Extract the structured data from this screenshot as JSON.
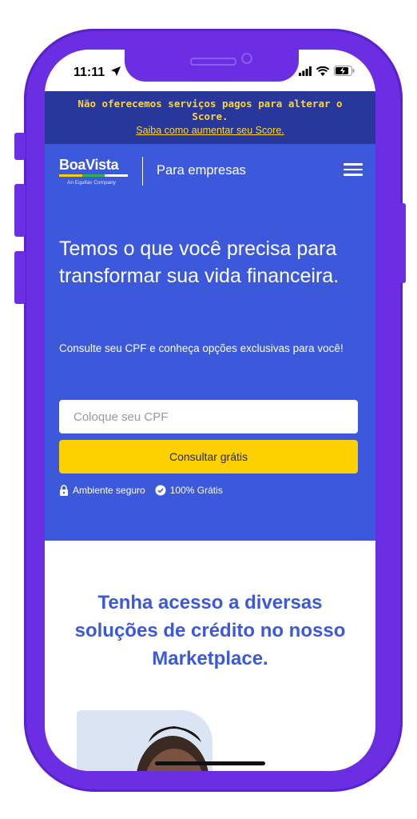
{
  "status_bar": {
    "time": "11:11"
  },
  "notice": {
    "text": "Não oferecemos serviços pagos para alterar o Score.",
    "link": "Saiba como aumentar seu Score."
  },
  "header": {
    "logo_text": "BoaVista",
    "logo_subtext": "An Equifax Company",
    "for_business": "Para empresas"
  },
  "hero": {
    "headline": "Temos o que você precisa para transformar sua vida financeira.",
    "subline": "Consulte seu CPF e conheça opções exclusivas para você!",
    "cpf_placeholder": "Coloque seu CPF",
    "cta_label": "Consultar grátis",
    "badge_secure": "Ambiente seguro",
    "badge_free": "100% Grátis"
  },
  "marketplace": {
    "title": "Tenha acesso a diversas soluções de crédito no nosso Marketplace."
  },
  "icons": {
    "location": "location-arrow-icon",
    "signal": "signal-icon",
    "wifi": "wifi-icon",
    "battery": "battery-charging-icon",
    "menu": "hamburger-menu-icon",
    "lock": "lock-icon",
    "check": "check-circle-icon"
  },
  "colors": {
    "frame": "#6b2ee3",
    "notice_bg": "#28389a",
    "notice_text": "#fdd435",
    "hero_bg": "#3c59dc",
    "cta_bg": "#fdd000",
    "title_blue": "#3c59dc"
  }
}
